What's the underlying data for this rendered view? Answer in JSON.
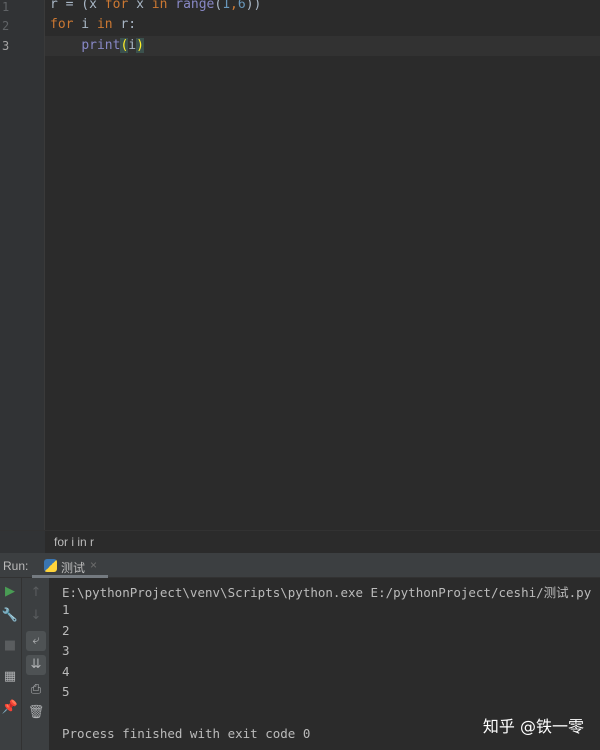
{
  "editor": {
    "line_numbers": [
      "1",
      "2",
      "3"
    ],
    "lines": [
      {
        "parts": [
          "r = (x ",
          "for",
          " x ",
          "in",
          " ",
          "range",
          "(",
          "1",
          ",",
          "6",
          "))"
        ]
      },
      {
        "parts": [
          "for",
          " i ",
          "in",
          " r:"
        ]
      },
      {
        "parts": [
          "    ",
          "print",
          "(",
          "i",
          ")"
        ]
      }
    ]
  },
  "breadcrumb": "for i in r",
  "run": {
    "label": "Run:",
    "tab": "测试",
    "close": "×",
    "icons": [
      "run-icon",
      "wrench-icon",
      "stop-icon",
      "layout-icon",
      "pin-icon",
      "up-arrow-icon",
      "down-arrow-icon",
      "soft-wrap-icon",
      "scroll-to-end-icon",
      "print-icon",
      "trash-icon"
    ],
    "output": [
      "E:\\pythonProject\\venv\\Scripts\\python.exe E:/pythonProject/ceshi/测试.py",
      "1",
      "2",
      "3",
      "4",
      "5",
      "",
      "Process finished with exit code 0"
    ]
  },
  "watermark": "知乎 @铁一零",
  "colors": {
    "keyword": "#cc7832",
    "builtin": "#8888c6",
    "number": "#6897bb",
    "text": "#a9b7c6"
  }
}
